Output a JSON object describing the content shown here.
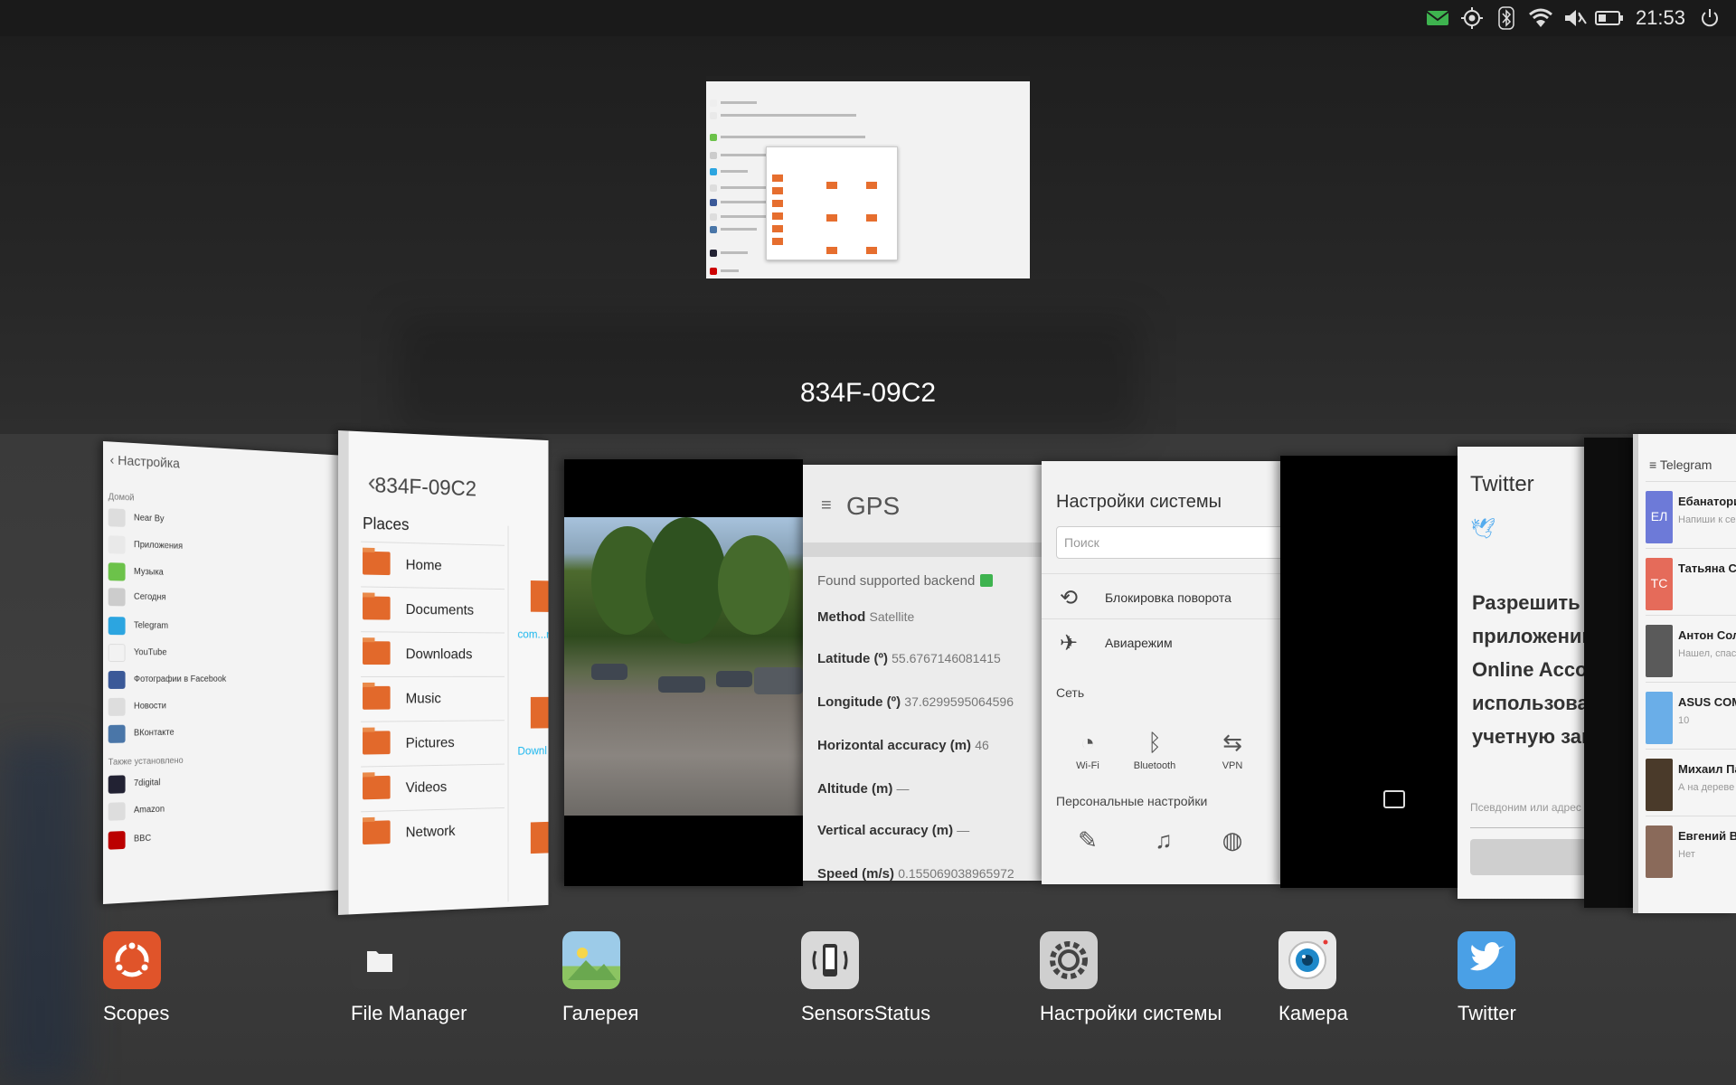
{
  "status_bar": {
    "time": "21:53",
    "indicators": [
      "mail-icon",
      "location-icon",
      "bluetooth-icon",
      "wifi-icon",
      "sound-muted-icon",
      "battery-icon",
      "power-icon"
    ],
    "mail_color": "#3eb34f"
  },
  "workspace": {
    "title": "834F-09C2"
  },
  "cards": {
    "settings": {
      "header": "Настройка",
      "section1": "Домой",
      "rows": [
        "Near By",
        "Приложения",
        "Музыка",
        "Сегодня",
        "Telegram",
        "YouTube",
        "Фотографии в Facebook",
        "Новости",
        "ВКонтакте"
      ],
      "section2": "Также установлено",
      "rows2": [
        "7digital",
        "Amazon",
        "BBC"
      ]
    },
    "file_manager": {
      "title": "834F-09C2",
      "places_label": "Places",
      "places": [
        "Home",
        "Documents",
        "Downloads",
        "Music",
        "Pictures",
        "Videos",
        "Network"
      ],
      "folder_labels": [
        "com...n",
        "Downl"
      ]
    },
    "gps": {
      "title": "GPS",
      "found": "Found supported backend",
      "method_label": "Method",
      "method_value": "Satellite",
      "lat_label": "Latitude (º)",
      "lat_value": "55.6767146081415",
      "lon_label": "Longitude (º)",
      "lon_value": "37.6299595064596",
      "hacc_label": "Horizontal accuracy (m)",
      "hacc_value": "46",
      "alt_label": "Altitude (m)",
      "alt_value": "—",
      "vacc_label": "Vertical accuracy (m)",
      "vacc_value": "—",
      "speed_label": "Speed (m/s)",
      "speed_value": "0.155069038965972"
    },
    "system_settings": {
      "title": "Настройки системы",
      "search_placeholder": "Поиск",
      "rotation_lock": "Блокировка поворота",
      "airplane": "Авиарежим",
      "network_section": "Сеть",
      "wifi": "Wi-Fi",
      "bluetooth": "Bluetooth",
      "vpn": "VPN",
      "personal_section": "Персональные настройки"
    },
    "twitter": {
      "title": "Twitter",
      "prompt": "Разрешить приложению U Online Account использовать учетную запис",
      "input_placeholder": "Псевдоним или адрес эл"
    },
    "telegram": {
      "title": "Telegram",
      "chats": [
        {
          "initials": "ЕЛ",
          "name": "Ебанаторий бы",
          "preview": "Напиши к сессии",
          "color": "#6d7ad8"
        },
        {
          "initials": "ТС",
          "name": "Татьяна Соловь",
          "preview": "",
          "color": "#e56b5a"
        },
        {
          "initials": "",
          "name": "Антон Соловьев",
          "preview": "Нашел, спасибо",
          "color": "#5a5a5a"
        },
        {
          "initials": "",
          "name": "ASUS COMPUTEX",
          "preview": "10",
          "color": "#6aaee8"
        },
        {
          "initials": "",
          "name": "Михаил Панюш",
          "preview": "А на дереве все",
          "color": "#4a3a2a"
        },
        {
          "initials": "",
          "name": "Евгений Вильдя",
          "preview": "Нет",
          "color": "#8a6a5a"
        }
      ]
    }
  },
  "dock": [
    {
      "label": "Scopes",
      "icon": "ubuntu-icon",
      "color": "#e0542a"
    },
    {
      "label": "File Manager",
      "icon": "folder-icon",
      "color": "#3a3a3a"
    },
    {
      "label": "Галерея",
      "icon": "gallery-icon",
      "color": "#8cc462"
    },
    {
      "label": "SensorsStatus",
      "icon": "phone-sensor-icon",
      "color": "#d9d9d9"
    },
    {
      "label": "Настройки системы",
      "icon": "gear-icon",
      "color": "#cfcfcf"
    },
    {
      "label": "Камера",
      "icon": "camera-icon",
      "color": "#e8e8e8"
    },
    {
      "label": "Twitter",
      "icon": "twitter-icon",
      "color": "#4aa0e6"
    }
  ]
}
